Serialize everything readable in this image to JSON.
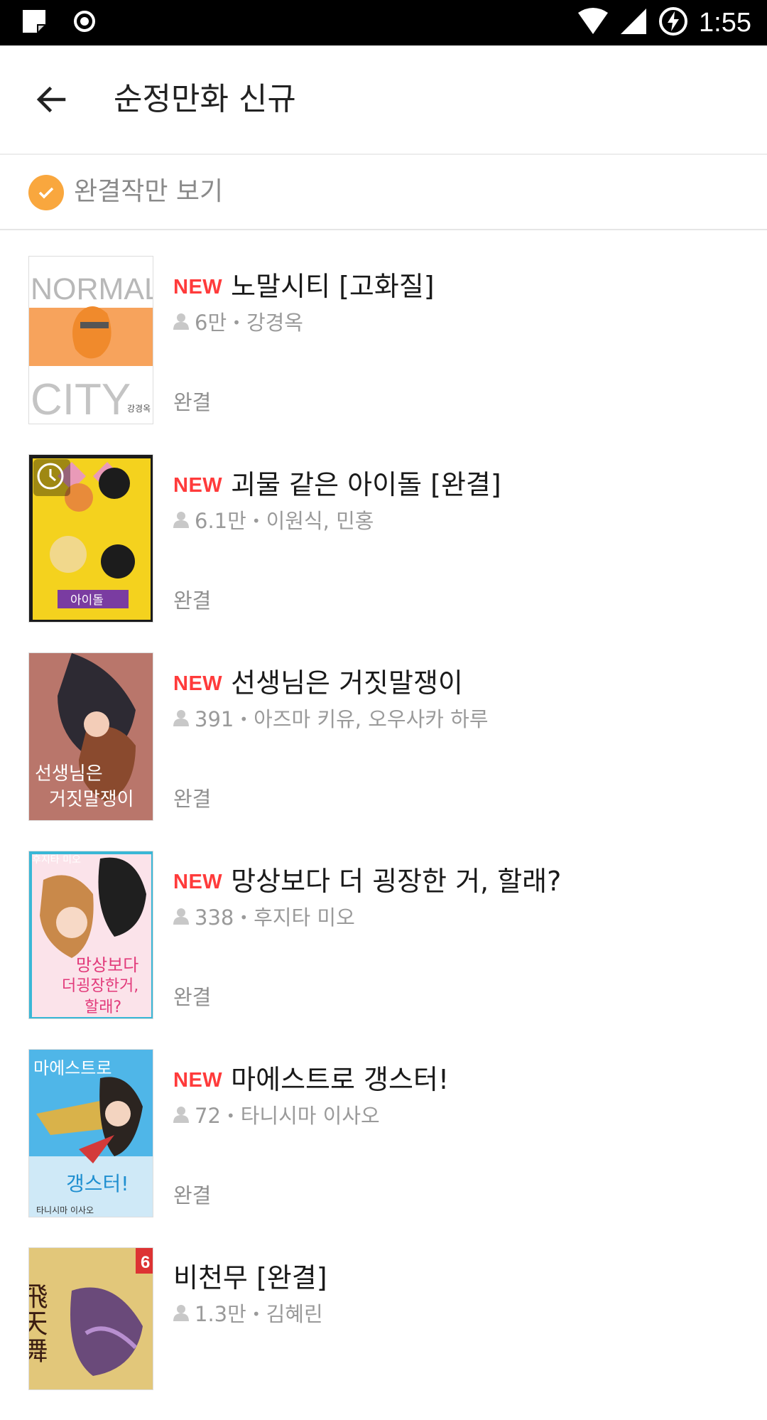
{
  "status_bar": {
    "time": "1:55"
  },
  "app_bar": {
    "title": "순정만화 신규"
  },
  "filter": {
    "label": "완결작만 보기",
    "checked": true,
    "accent": "#f9a73e"
  },
  "colors": {
    "new_badge": "#ff3b3b",
    "meta_text": "#9a9a9a"
  },
  "items": [
    {
      "badge": "NEW",
      "title": "노말시티 [고화질]",
      "views": "6만",
      "author": "강경옥",
      "status": "완결"
    },
    {
      "badge": "NEW",
      "title": "괴물 같은 아이돌 [완결]",
      "views": "6.1만",
      "author": "이원식, 민홍",
      "status": "완결"
    },
    {
      "badge": "NEW",
      "title": "선생님은 거짓말쟁이",
      "views": "391",
      "author": "아즈마 키유, 오우사카 하루",
      "status": "완결"
    },
    {
      "badge": "NEW",
      "title": "망상보다 더 굉장한 거, 할래?",
      "views": "338",
      "author": "후지타 미오",
      "status": "완결"
    },
    {
      "badge": "NEW",
      "title": "마에스트로 갱스터!",
      "views": "72",
      "author": "타니시마 이사오",
      "status": "완결"
    },
    {
      "badge": "",
      "title": "비천무 [완결]",
      "views": "1.3만",
      "author": "김혜린",
      "status": ""
    }
  ],
  "covers": {
    "item0": {
      "line1": "NORMAL",
      "line2": "CITY",
      "author": "강경옥"
    },
    "item1": {
      "banner": "아이돌"
    },
    "item2": {
      "line1": "선생님은",
      "line2": "거짓말쟁이"
    },
    "item3": {
      "top": "후지타 미오",
      "line1": "망상보다",
      "line2": "더굉장한거,",
      "line3": "할래?"
    },
    "item4": {
      "line1": "마에스트로",
      "line2": "갱스터!",
      "author": "타니시마 이사오"
    },
    "item5": {
      "chars": "飛天舞",
      "volume": "6"
    }
  }
}
